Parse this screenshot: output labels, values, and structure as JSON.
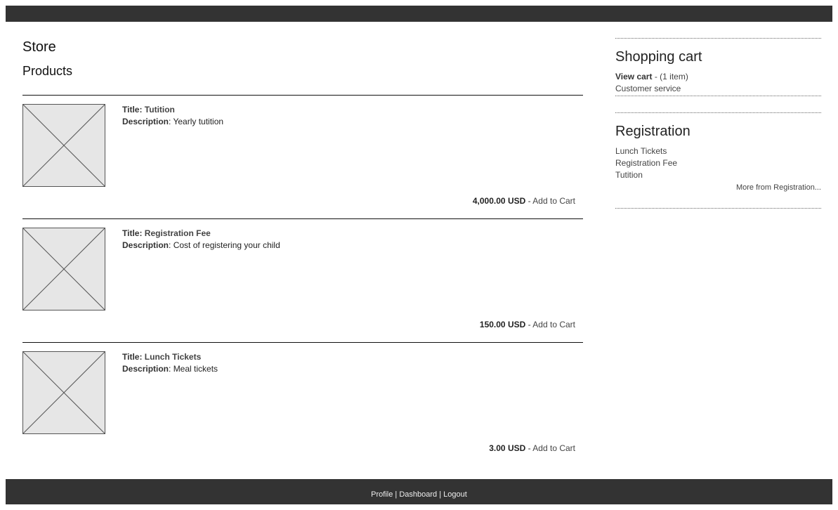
{
  "main": {
    "page_title": "Store",
    "section_title": "Products"
  },
  "labels": {
    "title": "Title:",
    "description": "Description",
    "currency": "USD",
    "add_to_cart": "Add to Cart"
  },
  "products": [
    {
      "title": "Tutition",
      "description": "Yearly tutition",
      "price": "4,000.00"
    },
    {
      "title": "Registration Fee",
      "description": "Cost of registering your child",
      "price": "150.00"
    },
    {
      "title": "Lunch Tickets",
      "description": "Meal tickets",
      "price": "3.00"
    }
  ],
  "sidebar": {
    "cart": {
      "heading": "Shopping cart",
      "view_cart": "View cart",
      "item_count": "(1 item)",
      "customer_service": "Customer service"
    },
    "registration": {
      "heading": "Registration",
      "items": [
        "Lunch Tickets",
        "Registration Fee",
        "Tutition"
      ],
      "more": "More from Registration..."
    }
  },
  "footer": {
    "profile": "Profile",
    "dashboard": "Dashboard",
    "logout": "Logout",
    "separator": "|"
  }
}
